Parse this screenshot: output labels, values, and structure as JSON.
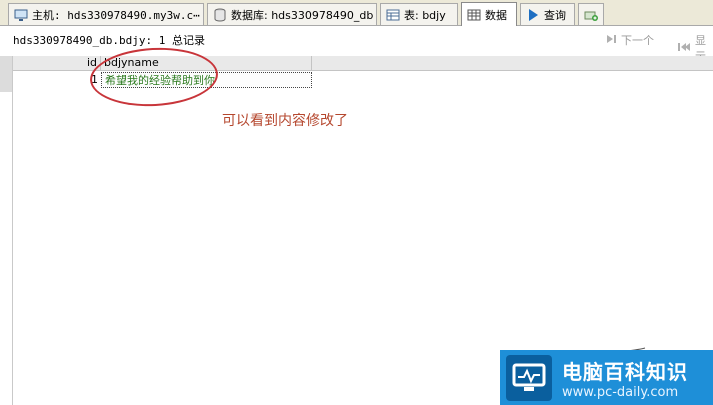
{
  "tabs": [
    {
      "icon": "monitor-icon",
      "label": "主机: hds330978490.my3w.c⋯",
      "active": false
    },
    {
      "icon": "database-icon",
      "label": "数据库: hds330978490_db",
      "active": false
    },
    {
      "icon": "table-icon",
      "label": "表: bdjy",
      "active": false
    },
    {
      "icon": "grid-data-icon",
      "label": "数据",
      "active": true
    },
    {
      "icon": "play-query-icon",
      "label": "查询",
      "active": false
    },
    {
      "icon": "new-query-tab-icon",
      "label": "",
      "active": false
    }
  ],
  "summary": {
    "text": "hds330978490_db.bdjy: 1 总记录"
  },
  "pager": {
    "next_label": "下一个",
    "last_label": "显示"
  },
  "grid": {
    "columns": [
      "id",
      "bdjyname"
    ],
    "rows": [
      {
        "id": "1",
        "bdjyname": "希望我的经验帮助到你"
      }
    ]
  },
  "annotation": {
    "text": "可以看到内容修改了"
  },
  "watermark": {
    "title": "电脑百科知识",
    "url": "www.pc-daily.com"
  },
  "colors": {
    "annotation": "#b5472e",
    "circle": "#c8353a",
    "selected_text": "#2b7a1e",
    "watermark_bg": "#1e8fd8"
  }
}
